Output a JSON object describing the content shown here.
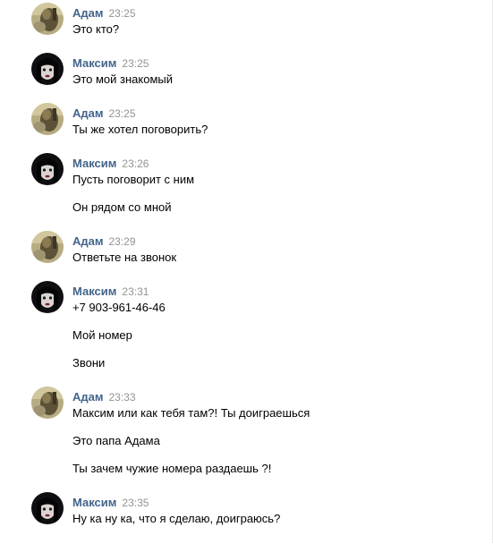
{
  "messages": [
    {
      "author": "Адам",
      "time": "23:25",
      "avatar": "adam-avatar",
      "lines": [
        "Это кто?"
      ]
    },
    {
      "author": "Максим",
      "time": "23:25",
      "avatar": "maksim-avatar",
      "lines": [
        "Это мой знакомый"
      ]
    },
    {
      "author": "Адам",
      "time": "23:25",
      "avatar": "adam-avatar",
      "lines": [
        "Ты же хотел поговорить?"
      ]
    },
    {
      "author": "Максим",
      "time": "23:26",
      "avatar": "maksim-avatar",
      "lines": [
        "Пусть поговорит с ним",
        "Он рядом со мной"
      ]
    },
    {
      "author": "Адам",
      "time": "23:29",
      "avatar": "adam-avatar",
      "lines": [
        "Ответьте на звонок"
      ]
    },
    {
      "author": "Максим",
      "time": "23:31",
      "avatar": "maksim-avatar",
      "lines": [
        "+7 903-961-46-46",
        "Мой номер",
        "Звони"
      ]
    },
    {
      "author": "Адам",
      "time": "23:33",
      "avatar": "adam-avatar",
      "lines": [
        "Максим или как тебя там?! Ты доиграешься",
        "Это папа Адама",
        "Ты зачем чужие номера раздаешь ?!"
      ]
    },
    {
      "author": "Максим",
      "time": "23:35",
      "avatar": "maksim-avatar",
      "lines": [
        "Ну ка ну ка, что я сделаю, доиграюсь?"
      ]
    }
  ],
  "colors": {
    "author": "#42648b",
    "time": "#939393",
    "text": "#000000",
    "divider": "#e7e8ec"
  }
}
